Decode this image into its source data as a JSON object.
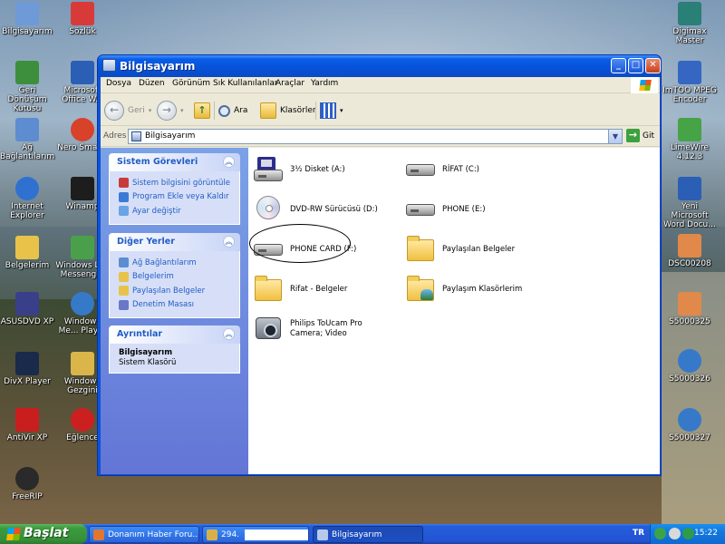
{
  "desktop": {
    "icons_left": [
      {
        "name": "mycomputer-desktop-icon",
        "label": "Bilgisayarım",
        "color": "#6f9ad8"
      },
      {
        "name": "recyclebin-desktop-icon",
        "label": "Geri Dönüşüm Kutusu",
        "color": "#3d8f3d"
      },
      {
        "name": "network-desktop-icon",
        "label": "Ağ Bağlantılarım",
        "color": "#5e8cd0"
      },
      {
        "name": "ie-desktop-icon",
        "label": "Internet Explorer",
        "color": "#2f71d0"
      },
      {
        "name": "mydocs-desktop-icon",
        "label": "Belgelerim",
        "color": "#e8c34a"
      },
      {
        "name": "asusdvd-desktop-icon",
        "label": "ASUSDVD XP",
        "color": "#3a3f8a"
      },
      {
        "name": "divx-desktop-icon",
        "label": "DivX Player",
        "color": "#1a2a4a"
      },
      {
        "name": "antivir-desktop-icon",
        "label": "AntiVir XP",
        "color": "#c81e1e"
      },
      {
        "name": "freerip-desktop-icon",
        "label": "FreeRIP",
        "color": "#2a2a2a"
      }
    ],
    "icons_col2": [
      {
        "name": "sozluk-desktop-icon",
        "label": "Sözlük",
        "color": "#d83a3a"
      },
      {
        "name": "office-desktop-icon",
        "label": "Microsoft Office W...",
        "color": "#2b5fb5"
      },
      {
        "name": "nero-desktop-icon",
        "label": "Nero Smar...",
        "color": "#d8412a"
      },
      {
        "name": "winamp-desktop-icon",
        "label": "Winamp",
        "color": "#1d1d1d"
      },
      {
        "name": "messenger-desktop-icon",
        "label": "Windows Li... Messenger",
        "color": "#4aa04a"
      },
      {
        "name": "mediaplayer-desktop-icon",
        "label": "Windows Me... Player",
        "color": "#3779c9"
      },
      {
        "name": "explorer-desktop-icon",
        "label": "Windows Gezgini",
        "color": "#d9b54a"
      },
      {
        "name": "eglence-desktop-icon",
        "label": "Eğlence",
        "color": "#cc2020"
      }
    ],
    "icons_right": [
      {
        "name": "digimax-desktop-icon",
        "label": "Digimax Master",
        "color": "#2a7f77"
      },
      {
        "name": "mpeg-encoder-desktop-icon",
        "label": "ImTOO MPEG Encoder",
        "color": "#3567c2"
      },
      {
        "name": "limewire-desktop-icon",
        "label": "LimeWire 4.12.3",
        "color": "#46a346"
      },
      {
        "name": "word-doc-desktop-icon",
        "label": "Yeni Microsoft Word Docu...",
        "color": "#2b5fb5"
      },
      {
        "name": "dsc-desktop-icon",
        "label": "DSC00208",
        "color": "#e0894a"
      },
      {
        "name": "s325-desktop-icon",
        "label": "S5000325",
        "color": "#e0894a"
      },
      {
        "name": "s326-desktop-icon",
        "label": "S5000326",
        "color": "#3779c9"
      },
      {
        "name": "s327-desktop-icon",
        "label": "S5000327",
        "color": "#3779c9"
      }
    ]
  },
  "window": {
    "title": "Bilgisayarım",
    "controls": {
      "minimize": "_",
      "maximize": "□",
      "close": "✕"
    },
    "menu": [
      "Dosya",
      "Düzen",
      "Görünüm",
      "Sık Kullanılanlar",
      "Araçlar",
      "Yardım"
    ],
    "toolbar": {
      "back": "Geri",
      "search": "Ara",
      "folders": "Klasörler"
    },
    "address": {
      "label": "Adres",
      "value": "Bilgisayarım",
      "go": "Git"
    },
    "left_pane": {
      "system_tasks": {
        "title": "Sistem Görevleri",
        "items": [
          {
            "label": "Sistem bilgisini görüntüle",
            "color": "#c83b3b"
          },
          {
            "label": "Program Ekle veya Kaldır",
            "color": "#3b7bd6"
          },
          {
            "label": "Ayar değiştir",
            "color": "#6aa3e6"
          }
        ]
      },
      "other_places": {
        "title": "Diğer Yerler",
        "items": [
          {
            "label": "Ağ Bağlantılarım",
            "color": "#5a8ed0"
          },
          {
            "label": "Belgelerim",
            "color": "#e8c34a"
          },
          {
            "label": "Paylaşılan Belgeler",
            "color": "#e8c34a"
          },
          {
            "label": "Denetim Masası",
            "color": "#6a78c8"
          }
        ]
      },
      "details": {
        "title": "Ayrıntılar",
        "name": "Bilgisayarım",
        "type": "Sistem Klasörü"
      }
    },
    "items": [
      {
        "label": "3½ Disket (A:)",
        "kind": "floppy"
      },
      {
        "label": "RİFAT (C:)",
        "kind": "drive"
      },
      {
        "label": "DVD-RW Sürücüsü (D:)",
        "kind": "disc"
      },
      {
        "label": "PHONE (E:)",
        "kind": "drive"
      },
      {
        "label": "PHONE CARD (F:)",
        "kind": "drive"
      },
      {
        "label": "Paylaşılan Belgeler",
        "kind": "folder"
      },
      {
        "label": "Rifat - Belgeler",
        "kind": "folder"
      },
      {
        "label": "Paylaşım Klasörlerim",
        "kind": "folder-shared"
      },
      {
        "label": "Philips ToUcam Pro Camera; Video",
        "kind": "camera"
      }
    ]
  },
  "taskbar": {
    "start": "Başlat",
    "tasks": [
      {
        "label": "Donanım Haber Foru...",
        "active": false
      },
      {
        "label": "294.",
        "active": false
      },
      {
        "label": "Bilgisayarım",
        "active": true
      }
    ],
    "language": "TR",
    "clock": "15:22"
  }
}
